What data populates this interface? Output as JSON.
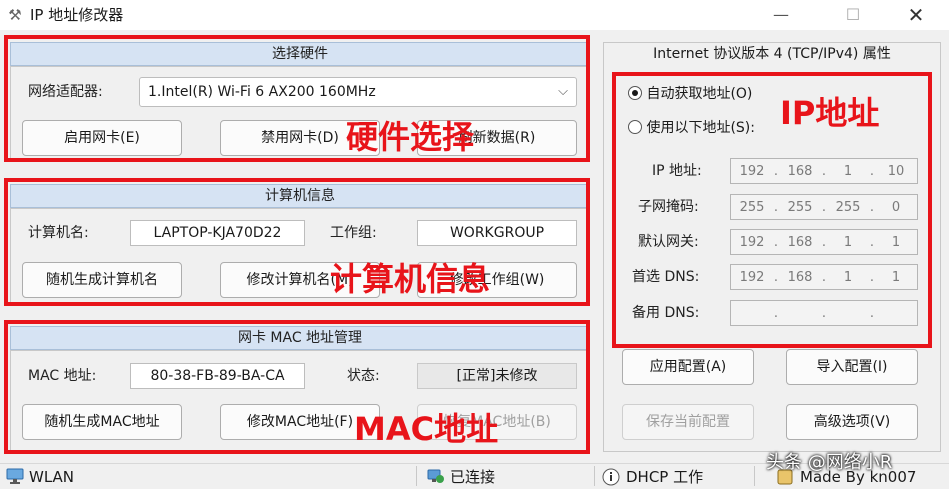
{
  "window": {
    "title": "IP 地址修改器",
    "icon": "tools-icon",
    "minimize_glyph": "—",
    "maximize_glyph": "☐",
    "close_glyph": "✕"
  },
  "hardware": {
    "header": "选择硬件",
    "adapter_label": "网络适配器:",
    "adapter_value": "1.Intel(R) Wi-Fi 6 AX200 160MHz",
    "enable_button": "启用网卡(E)",
    "disable_button": "禁用网卡(D)",
    "refresh_button": "刷新数据(R)",
    "annotation": "硬件选择"
  },
  "computer": {
    "header": "计算机信息",
    "name_label": "计算机名:",
    "name_value": "LAPTOP-KJA70D22",
    "workgroup_label": "工作组:",
    "workgroup_value": "WORKGROUP",
    "random_name_button": "随机生成计算机名",
    "modify_name_button": "修改计算机名(M)",
    "modify_workgroup_button": "修改工作组(W)",
    "annotation": "计算机信息"
  },
  "mac": {
    "header": "网卡 MAC 地址管理",
    "mac_label": "MAC 地址:",
    "mac_value": "80-38-FB-89-BA-CA",
    "status_label": "状态:",
    "status_value": "[正常]未修改",
    "random_mac_button": "随机生成MAC地址",
    "modify_mac_button": "修改MAC地址(F)",
    "restore_mac_button": "恢复MAC地址(B)",
    "annotation": "MAC地址"
  },
  "ipv4": {
    "header": "Internet 协议版本 4 (TCP/IPv4) 属性",
    "auto_option": "自动获取地址(O)",
    "manual_option": "使用以下地址(S):",
    "selected": "auto",
    "annotation": "IP地址",
    "ip_label": "IP 地址:",
    "ip_value": [
      "192",
      "168",
      "1",
      "10"
    ],
    "subnet_label": "子网掩码:",
    "subnet_value": [
      "255",
      "255",
      "255",
      "0"
    ],
    "gateway_label": "默认网关:",
    "gateway_value": [
      "192",
      "168",
      "1",
      "1"
    ],
    "dns1_label": "首选 DNS:",
    "dns1_value": [
      "192",
      "168",
      "1",
      "1"
    ],
    "dns2_label": "备用 DNS:",
    "dns2_value": [
      "",
      "",
      "",
      ""
    ],
    "apply_button": "应用配置(A)",
    "import_button": "导入配置(I)",
    "save_button": "保存当前配置",
    "advanced_button": "高级选项(V)"
  },
  "statusbar": {
    "network": "WLAN",
    "connection": "已连接",
    "dhcp": "DHCP 工作",
    "author": "Made By kn007",
    "watermark": "头条 @网络小R"
  },
  "colors": {
    "annotation_red": "#e8141a",
    "header_blue": "#d6e3f3"
  }
}
